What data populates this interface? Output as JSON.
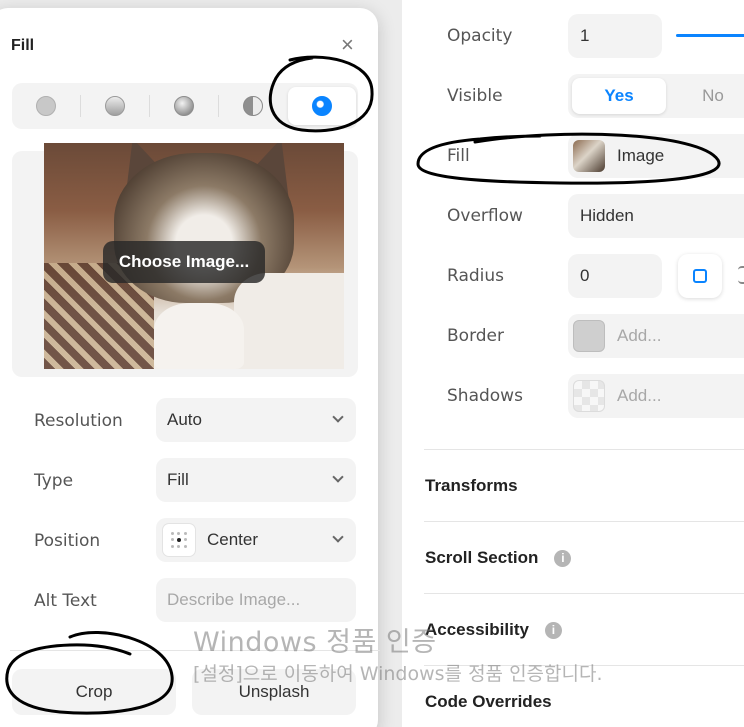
{
  "properties": {
    "opacity": {
      "label": "Opacity",
      "value": "1"
    },
    "visible": {
      "label": "Visible",
      "yes": "Yes",
      "no": "No",
      "selected": "Yes"
    },
    "fill": {
      "label": "Fill",
      "value": "Image"
    },
    "overflow": {
      "label": "Overflow",
      "value": "Hidden"
    },
    "radius": {
      "label": "Radius",
      "value": "0"
    },
    "border": {
      "label": "Border",
      "placeholder": "Add..."
    },
    "shadows": {
      "label": "Shadows",
      "placeholder": "Add..."
    }
  },
  "sections": {
    "transforms": "Transforms",
    "scroll_section": "Scroll Section",
    "accessibility": "Accessibility",
    "code_overrides": "Code Overrides"
  },
  "popover": {
    "title": "Fill",
    "close_glyph": "×",
    "fill_types": [
      "solid",
      "linear-gradient",
      "radial-gradient",
      "conic-gradient",
      "image"
    ],
    "selected_fill_type": "image",
    "choose_image": "Choose Image...",
    "resolution": {
      "label": "Resolution",
      "value": "Auto"
    },
    "type": {
      "label": "Type",
      "value": "Fill"
    },
    "position": {
      "label": "Position",
      "value": "Center"
    },
    "alt_text": {
      "label": "Alt Text",
      "placeholder": "Describe Image..."
    },
    "crop_button": "Crop",
    "unsplash_button": "Unsplash"
  },
  "watermark": {
    "line1": "Windows 정품 인증",
    "line2": "[설정]으로 이동하여 Windows를 정품 인증합니다."
  },
  "colors": {
    "accent": "#0a84ff",
    "panel_bg": "#ffffff",
    "field_bg": "#f3f3f3",
    "annotation_ink": "#000000"
  }
}
